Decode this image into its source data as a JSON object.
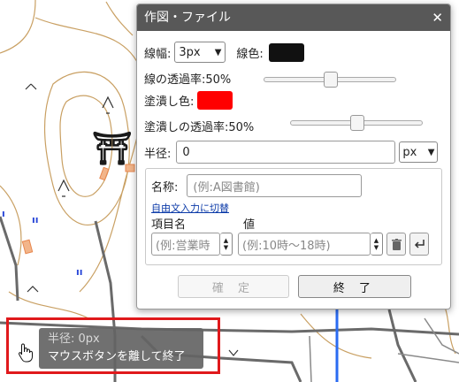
{
  "dialog": {
    "title": "作図・ファイル",
    "close_glyph": "✕",
    "line_width": {
      "label": "線幅:",
      "value": "3px"
    },
    "line_color": {
      "label": "線色:",
      "color": "#111111"
    },
    "line_opacity": {
      "label": "線の透過率:50%",
      "value": 0.5
    },
    "fill_color": {
      "label": "塗潰し色:",
      "color": "#ff0000"
    },
    "fill_opacity": {
      "label": "塗潰しの透過率:50%",
      "value": 0.5
    },
    "radius": {
      "label": "半径:",
      "value": "0",
      "unit": "px"
    },
    "props": {
      "name_label": "名称:",
      "name_placeholder": "(例:A図書館)",
      "free_input_link": "自由文入力に切替",
      "item_header": "項目名",
      "value_header": "値",
      "item_placeholder": "(例:営業時",
      "value_placeholder": "(例:10時～18時)"
    },
    "confirm_label": "確 定",
    "finish_label": "終 了"
  },
  "tooltip": {
    "line1": "半径: 0px",
    "line2": "マウスボタンを離して終了"
  },
  "map": {
    "colors": {
      "contour": "#c9a063",
      "road": "#6a6a6a",
      "river": "#2a6bf2",
      "building": "#e8874e"
    },
    "symbols": {
      "shrine": "⛩",
      "paddy": "ıı",
      "wasteland": "∧"
    }
  }
}
